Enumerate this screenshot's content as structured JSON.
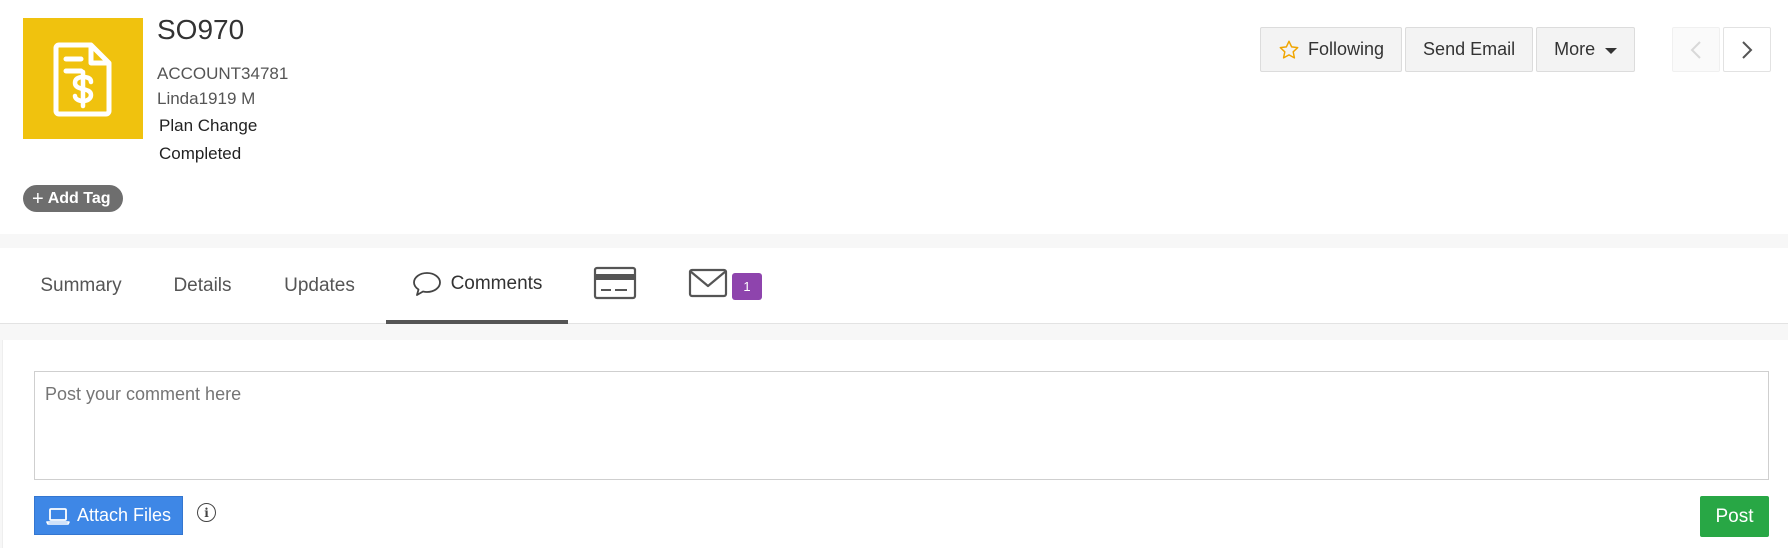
{
  "record": {
    "title": "SO970",
    "account": "ACCOUNT34781",
    "contact": "Linda1919 M",
    "type": "Plan Change",
    "status": "Completed",
    "add_tag_label": "Add Tag",
    "icon": "invoice-dollar-icon",
    "icon_color": "#f0c20e"
  },
  "actions": {
    "following_label": "Following",
    "send_email_label": "Send Email",
    "more_label": "More"
  },
  "tabs": [
    {
      "label": "Summary",
      "active": false
    },
    {
      "label": "Details",
      "active": false
    },
    {
      "label": "Updates",
      "active": false
    },
    {
      "label": "Comments",
      "active": true,
      "icon": "speech-bubble-icon"
    },
    {
      "label": "",
      "icon": "credit-card-icon"
    },
    {
      "label": "",
      "icon": "envelope-icon",
      "badge": "1"
    }
  ],
  "comment": {
    "placeholder": "Post your comment here",
    "attach_label": "Attach Files",
    "info_glyph": "i",
    "post_label": "Post"
  },
  "colors": {
    "accent_blue": "#3e87e6",
    "post_green": "#28a745",
    "badge_purple": "#8e44ad",
    "star_orange": "#f0a500"
  }
}
